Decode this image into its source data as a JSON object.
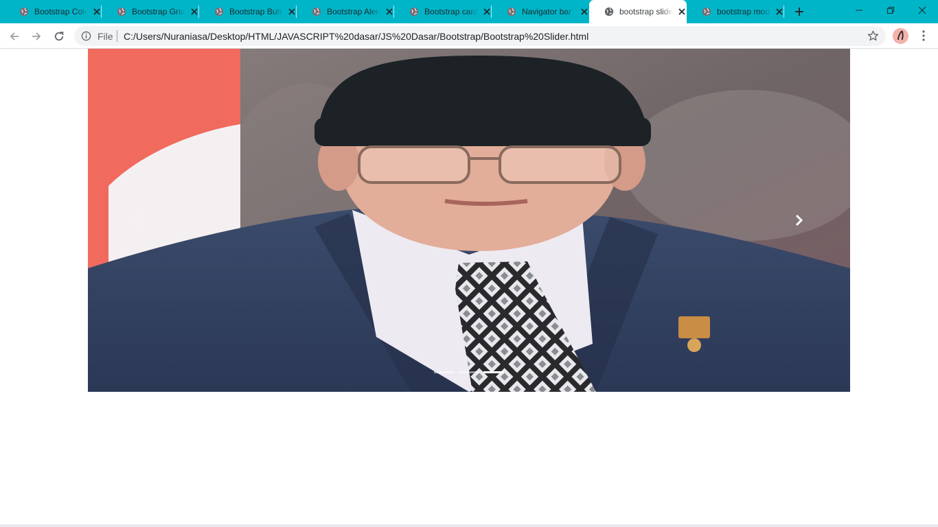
{
  "browser": {
    "tabs": [
      {
        "title": "Bootstrap Colors",
        "active": false
      },
      {
        "title": "Bootstrap Grid",
        "active": false
      },
      {
        "title": "Bootstrap Buttons",
        "active": false
      },
      {
        "title": "Bootstrap Alerts",
        "active": false
      },
      {
        "title": "Bootstrap card",
        "active": false
      },
      {
        "title": "Navigator bar",
        "active": false
      },
      {
        "title": "bootstrap slider",
        "active": true
      },
      {
        "title": "bootstrap modal",
        "active": false
      }
    ],
    "address_bar": {
      "scheme_label": "File",
      "url": "C:/Users/Nuraniasa/Desktop/HTML/JAVASCRIPT%20dasar/JS%20Dasar/Bootstrap/Bootstrap%20Slider.html"
    },
    "colors": {
      "tab_strip": "#00b5c8",
      "active_tab": "#ffffff",
      "omnibox": "#f1f3f4"
    },
    "icons": [
      "globe-icon",
      "close-icon",
      "plus-icon",
      "back-arrow-icon",
      "forward-arrow-icon",
      "reload-icon",
      "info-icon",
      "star-icon",
      "kebab-menu-icon",
      "minimize-icon",
      "restore-icon"
    ]
  },
  "carousel": {
    "slide_count": 3,
    "active_index": 2,
    "prev_icon": "chevron-left-icon",
    "next_icon": "chevron-right-icon"
  }
}
